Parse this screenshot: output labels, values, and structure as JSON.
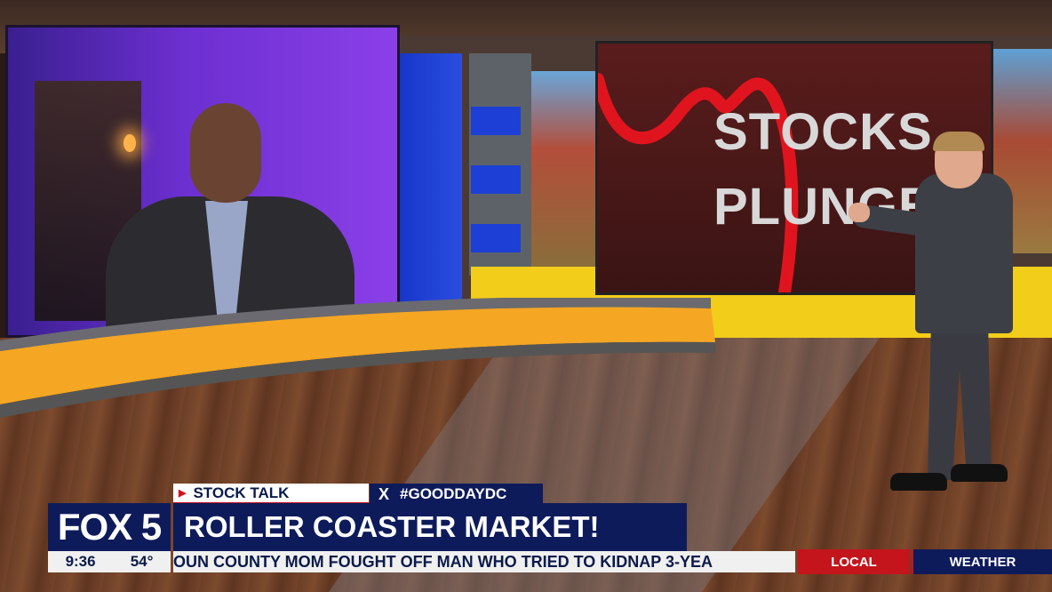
{
  "screen": {
    "line1": "STOCKS",
    "line2": "PLUNGE"
  },
  "lower_third": {
    "category": "STOCK TALK",
    "hashtag": "#GOODDAYDC",
    "x_icon_glyph": "X",
    "station_logo": "FOX 5",
    "headline": "ROLLER COASTER MARKET!",
    "time": "9:36",
    "temperature": "54°",
    "ticker_text": "OUN COUNTY MOM FOUGHT OFF MAN WHO TRIED TO KIDNAP 3-YEA",
    "nav_local": "LOCAL",
    "nav_weather": "WEATHER"
  },
  "colors": {
    "navy": "#0e1b5a",
    "red": "#c4141c",
    "studio_yellow": "#f2cd1a",
    "studio_blue": "#1d3fd6"
  }
}
